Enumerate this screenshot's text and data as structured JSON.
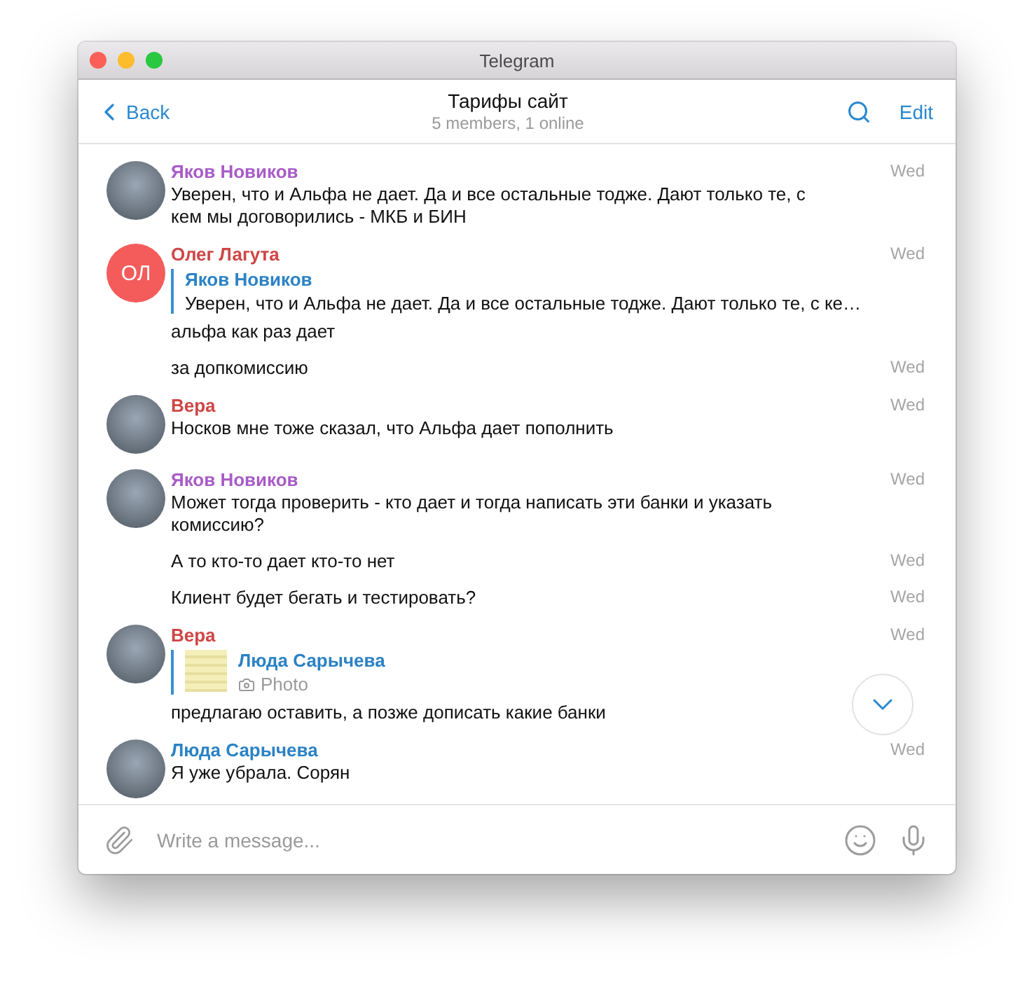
{
  "window": {
    "title": "Telegram"
  },
  "header": {
    "back": "Back",
    "title": "Тарифы сайт",
    "subtitle": "5 members, 1 online",
    "edit": "Edit"
  },
  "messages": [
    {
      "kind": "head",
      "author": "Яков Новиков",
      "color": "#a85bc7",
      "avatar": {
        "kind": "photo"
      },
      "time": "Wed",
      "text": "Уверен, что и Альфа не дает. Да и все остальные  тодже. Дают только те, с кем мы договорились - МКБ и БИН"
    },
    {
      "kind": "head",
      "author": "Олег Лагута",
      "color": "#cf4646",
      "avatar": {
        "kind": "initials",
        "initials": "ОЛ",
        "color": "#f45c5c"
      },
      "time": "Wed",
      "reply": {
        "kind": "text",
        "author": "Яков Новиков",
        "text": "Уверен, что и Альфа не дает. Да и все остальные  тодже. Дают только те, с ке…"
      },
      "text": "альфа как раз дает"
    },
    {
      "kind": "line",
      "time": "Wed",
      "text": "за допкомиссию"
    },
    {
      "kind": "head",
      "author": "Вера",
      "color": "#cf4646",
      "avatar": {
        "kind": "photo"
      },
      "time": "Wed",
      "text": "Носков мне тоже сказал, что Альфа дает пополнить"
    },
    {
      "kind": "head",
      "author": "Яков Новиков",
      "color": "#a85bc7",
      "avatar": {
        "kind": "photo"
      },
      "time": "Wed",
      "text": "Может тогда проверить - кто дает и тогда написать эти банки и указать комиссию?"
    },
    {
      "kind": "line",
      "time": "Wed",
      "text": "А то кто-то дает кто-то нет"
    },
    {
      "kind": "line",
      "time": "Wed",
      "text": "Клиент будет бегать и тестировать?"
    },
    {
      "kind": "head",
      "author": "Вера",
      "color": "#cf4646",
      "avatar": {
        "kind": "photo"
      },
      "time": "Wed",
      "reply": {
        "kind": "photo",
        "author": "Люда Сарычева",
        "text": "Photo"
      },
      "text": "предлагаю оставить, а позже дописать какие банки"
    },
    {
      "kind": "head",
      "author": "Люда Сарычева",
      "color": "#2b82c4",
      "avatar": {
        "kind": "photo"
      },
      "time": "Wed",
      "text": "Я уже убрала. Сорян"
    }
  ],
  "composer": {
    "placeholder": "Write a message..."
  }
}
